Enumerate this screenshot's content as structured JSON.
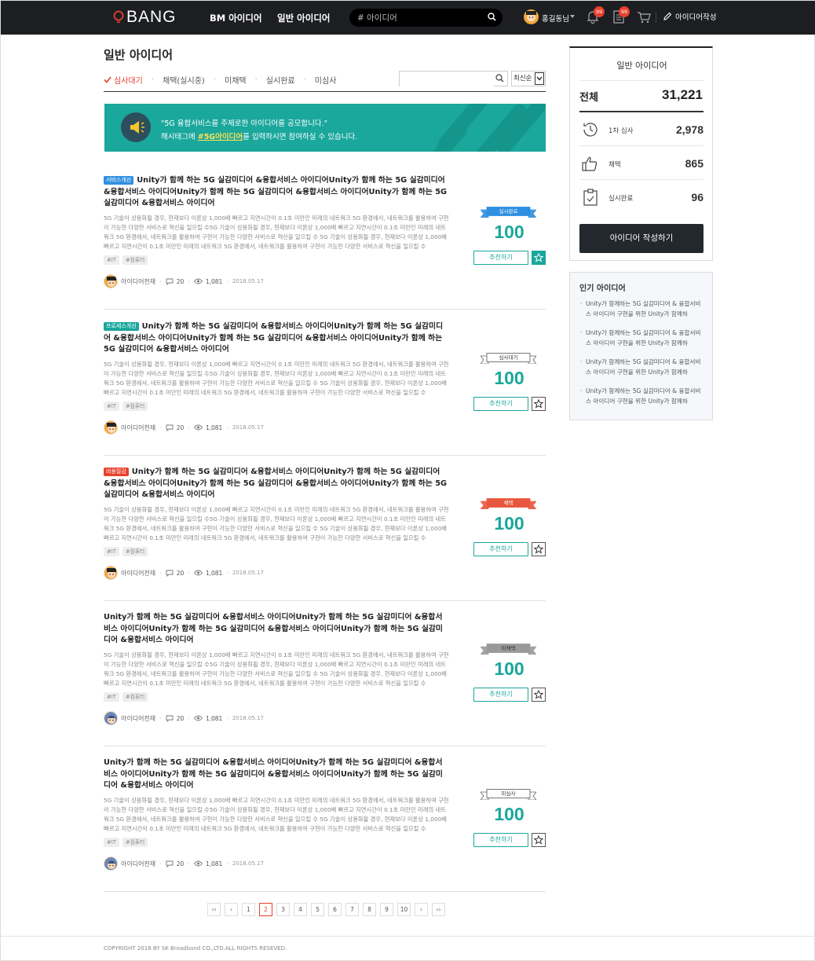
{
  "header": {
    "logo": "BANG",
    "nav": [
      "BM 아이디어",
      "일반 아이디어"
    ],
    "search_placeholder": "# 아이디어",
    "user_name": "홍길동님",
    "notif_count": "99",
    "doc_count": "99",
    "write_label": "아이디어작성"
  },
  "page": {
    "title": "일반 아이디어",
    "tabs": [
      "심사대기",
      "채택(실시중)",
      "미채택",
      "실시완료",
      "미심사"
    ],
    "active_tab": 0,
    "sort_label": "최신순"
  },
  "banner": {
    "line1": "\"5G 융합서비스를 주제로한 아이디어를 공모합니다.\"",
    "line2_pre": "해시태그에 ",
    "line2_hl": "#5G아이디어",
    "line2_post": "를 입력하시면 참여하실 수 있습니다."
  },
  "colors": {
    "accent": "#1aa79c",
    "red": "#e8402d",
    "dark": "#1c1e22"
  },
  "cards": [
    {
      "tag": "서비스개선",
      "tag_color": "#2f8fe0",
      "title": "Unity가 함께 하는 5G 실감미디어 &융합서비스 아이디어Unity가 함께 하는 5G 실감미디어 &융합서비스 아이디어Unity가 함께 하는 5G 실감미디어 &융합서비스 아이디어Unity가 함께 하는 5G 실감미디어 &융합서비스 아이디어",
      "desc": "5G 기술이 상용화될 경우, 현재보다 이론상 1,000배 빠르고 지연시간이 0.1초 미만인 미래의 네트워크 5G 환경에서, 네트워크를 활용하여 구현이 가능한 다양한 서비스로 혁신을 일으킬 수5G 기술이 상용화될 경우, 현재보다 이론상 1,000배 빠르고 지연시간이 0.1초 미만인 미래의 네트워크 5G 환경에서, 네트워크를 활용하여 구현이 가능한 다양한 서비스로 혁신을 일으킬 수 5G 기술이 상용화될 경우, 현재보다 이론상 1,000배 빠르고 지연시간이 0.1초 미만인 미래의 네트워크 5G 환경에서, 네트워크를 활용하여 구현이 가능한 다양한 서비스로 혁신을 일으킬 수",
      "hashtags": [
        "#IT",
        "#컴퓨터"
      ],
      "author": "아이디어천재",
      "comments": "20",
      "views": "1,081",
      "date": "2018.05.17",
      "status": "실시완료",
      "status_style": "blue",
      "score": "100",
      "rec_label": "추천하기",
      "starred": true
    },
    {
      "tag": "프로세스개선",
      "tag_color": "#1aa79c",
      "title": "Unity가 함께 하는 5G 실감미디어 &융합서비스 아이디어Unity가 함께 하는 5G 실감미디어 &융합서비스 아이디어Unity가 함께 하는 5G 실감미디어 &융합서비스 아이디어Unity가 함께 하는 5G 실감미디어 &융합서비스 아이디어",
      "desc": "5G 기술이 상용화될 경우, 현재보다 이론상 1,000배 빠르고 지연시간이 0.1초 미만인 미래의 네트워크 5G 환경에서, 네트워크를 활용하여 구현이 가능한 다양한 서비스로 혁신을 일으킬 수5G 기술이 상용화될 경우, 현재보다 이론상 1,000배 빠르고 지연시간이 0.1초 미만인 미래의 네트워크 5G 환경에서, 네트워크를 활용하여 구현이 가능한 다양한 서비스로 혁신을 일으킬 수 5G 기술이 상용화될 경우, 현재보다 이론상 1,000배 빠르고 지연시간이 0.1초 미만인 미래의 네트워크 5G 환경에서, 네트워크를 활용하여 구현이 가능한 다양한 서비스로 혁신을 일으킬 수",
      "hashtags": [
        "#IT",
        "#컴퓨터"
      ],
      "author": "아이디어천재",
      "comments": "20",
      "views": "1,081",
      "date": "2018.05.17",
      "status": "심사대기",
      "status_style": "white",
      "score": "100",
      "rec_label": "추천하기",
      "starred": false
    },
    {
      "tag": "비용절감",
      "tag_color": "#e8402d",
      "title": "Unity가 함께 하는 5G 실감미디어 &융합서비스 아이디어Unity가 함께 하는 5G 실감미디어 &융합서비스 아이디어Unity가 함께 하는 5G 실감미디어 &융합서비스 아이디어Unity가 함께 하는 5G 실감미디어 &융합서비스 아이디어",
      "desc": "5G 기술이 상용화될 경우, 현재보다 이론상 1,000배 빠르고 지연시간이 0.1초 미만인 미래의 네트워크 5G 환경에서, 네트워크를 활용하여 구현이 가능한 다양한 서비스로 혁신을 일으킬 수5G 기술이 상용화될 경우, 현재보다 이론상 1,000배 빠르고 지연시간이 0.1초 미만인 미래의 네트워크 5G 환경에서, 네트워크를 활용하여 구현이 가능한 다양한 서비스로 혁신을 일으킬 수 5G 기술이 상용화될 경우, 현재보다 이론상 1,000배 빠르고 지연시간이 0.1초 미만인 미래의 네트워크 5G 환경에서, 네트워크를 활용하여 구현이 가능한 다양한 서비스로 혁신을 일으킬 수",
      "hashtags": [
        "#IT",
        "#컴퓨터"
      ],
      "author": "아이디어천재",
      "comments": "20",
      "views": "1,081",
      "date": "2018.05.17",
      "status": "채택",
      "status_style": "red",
      "score": "100",
      "rec_label": "추천하기",
      "starred": false
    },
    {
      "tag": "",
      "tag_color": "",
      "title": "Unity가 함께 하는 5G 실감미디어 &융합서비스 아이디어Unity가 함께 하는 5G 실감미디어 &융합서비스 아이디어Unity가 함께 하는 5G 실감미디어 &융합서비스 아이디어Unity가 함께 하는 5G 실감미디어 &융합서비스 아이디어",
      "desc": "5G 기술이 상용화될 경우, 현재보다 이론상 1,000배 빠르고 지연시간이 0.1초 미만인 미래의 네트워크 5G 환경에서, 네트워크를 활용하여 구현이 가능한 다양한 서비스로 혁신을 일으킬 수5G 기술이 상용화될 경우, 현재보다 이론상 1,000배 빠르고 지연시간이 0.1초 미만인 미래의 네트워크 5G 환경에서, 네트워크를 활용하여 구현이 가능한 다양한 서비스로 혁신을 일으킬 수 5G 기술이 상용화될 경우, 현재보다 이론상 1,000배 빠르고 지연시간이 0.1초 미만인 미래의 네트워크 5G 환경에서, 네트워크를 활용하여 구현이 가능한 다양한 서비스로 혁신을 일으킬 수",
      "hashtags": [
        "#IT",
        "#컴퓨터"
      ],
      "author": "아이디어천재",
      "comments": "20",
      "views": "1,081",
      "date": "2018.05.17",
      "status": "미채택",
      "status_style": "gray",
      "score": "100",
      "rec_label": "추천하기",
      "starred": false
    },
    {
      "tag": "",
      "tag_color": "",
      "title": "Unity가 함께 하는 5G 실감미디어 &융합서비스 아이디어Unity가 함께 하는 5G 실감미디어 &융합서비스 아이디어Unity가 함께 하는 5G 실감미디어 &융합서비스 아이디어Unity가 함께 하는 5G 실감미디어 &융합서비스 아이디어",
      "desc": "5G 기술이 상용화될 경우, 현재보다 이론상 1,000배 빠르고 지연시간이 0.1초 미만인 미래의 네트워크 5G 환경에서, 네트워크를 활용하여 구현이 가능한 다양한 서비스로 혁신을 일으킬 수5G 기술이 상용화될 경우, 현재보다 이론상 1,000배 빠르고 지연시간이 0.1초 미만인 미래의 네트워크 5G 환경에서, 네트워크를 활용하여 구현이 가능한 다양한 서비스로 혁신을 일으킬 수 5G 기술이 상용화될 경우, 현재보다 이론상 1,000배 빠르고 지연시간이 0.1초 미만인 미래의 네트워크 5G 환경에서, 네트워크를 활용하여 구현이 가능한 다양한 서비스로 혁신을 일으킬 수",
      "hashtags": [
        "#IT",
        "#컴퓨터"
      ],
      "author": "아이디어천재",
      "comments": "20",
      "views": "1,081",
      "date": "2018.05.17",
      "status": "미심사",
      "status_style": "white",
      "score": "100",
      "rec_label": "추천하기",
      "starred": false
    }
  ],
  "pagination": {
    "first": "‹‹",
    "prev": "‹",
    "pages": [
      "1",
      "2",
      "3",
      "4",
      "5",
      "6",
      "7",
      "8",
      "9",
      "10"
    ],
    "current": "2",
    "next": "›",
    "last": "››"
  },
  "footer": "COPYRIGHT 2018 BY SK Broadband CO.,LTD.ALL RIGHTS RESEVED.",
  "sidebar": {
    "title": "일반 아이디어",
    "total_label": "전체",
    "total_value": "31,221",
    "stats": [
      {
        "icon": "clock-icon",
        "label": "1차 심사",
        "value": "2,978"
      },
      {
        "icon": "thumbs-up-icon",
        "label": "채택",
        "value": "865"
      },
      {
        "icon": "clipboard-check-icon",
        "label": "실시완료",
        "value": "96"
      }
    ],
    "write_btn": "아이디어 작성하기",
    "popular_title": "인기 아이디어",
    "popular": [
      "Unity가 함께하는 5G 실감미디어 & 융합서비스 아이디어 구현을 위한 Unity가 함께하",
      "Unity가 함께하는 5G 실감미디어 & 융합서비스 아이디어 구현을 위한 Unity가 함께하",
      "Unity가 함께하는 5G 실감미디어 & 융합서비스 아이디어 구현을 위한 Unity가 함께하",
      "Unity가 함께하는 5G 실감미디어 & 융합서비스 아이디어 구현을 위한 Unity가 함께하"
    ]
  }
}
